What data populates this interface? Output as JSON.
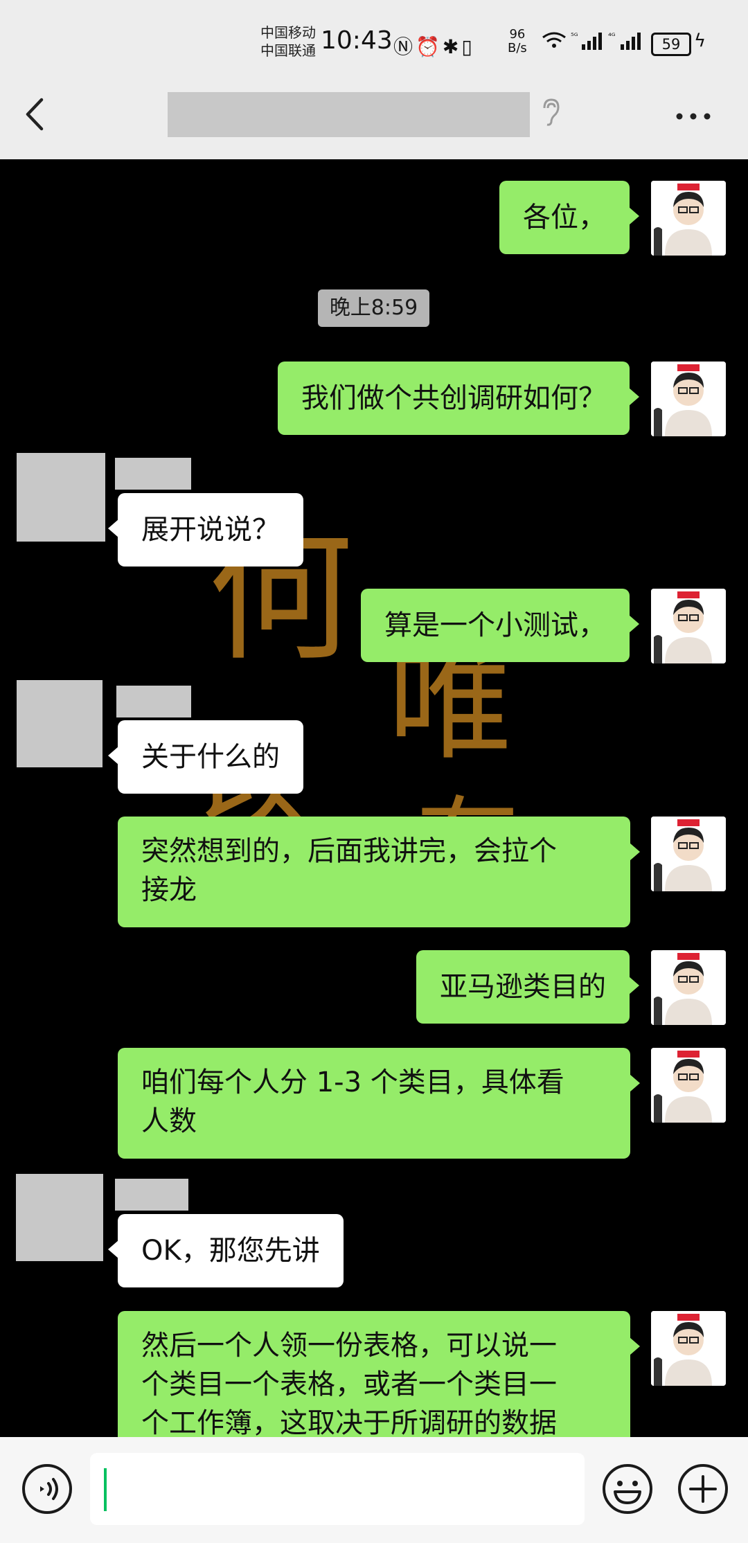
{
  "statusbar": {
    "carrier_1": "中国移动",
    "carrier_2": "中国联通",
    "time": "10:43",
    "icons": "Ⓝ⏰✱▯",
    "speed_value": "96",
    "speed_unit": "B/s",
    "signal_1": "⁶ᵍ",
    "signal_2": "⁵ᴳ",
    "signal_3": "⁴ᴳ",
    "battery": "59"
  },
  "header": {
    "back_icon": "chevron-left-icon",
    "ear_icon": "ear-icon",
    "more_icon": "more-icon"
  },
  "colors": {
    "sent_bubble": "#95ec69",
    "recv_bubble": "#ffffff",
    "bar_bg": "#ededed",
    "chat_bg": "#000000",
    "calligraphy": "#b57a1d"
  },
  "background": {
    "calligraphy_chars": [
      "何",
      "以",
      "唯",
      "有"
    ]
  },
  "messages": [
    {
      "side": "sent",
      "text": "各位，"
    },
    {
      "side": "time",
      "text": "晚上8:59"
    },
    {
      "side": "sent",
      "text": "我们做个共创调研如何？"
    },
    {
      "side": "recv",
      "text": "展开说说？"
    },
    {
      "side": "sent",
      "text": "算是一个小测试，"
    },
    {
      "side": "recv",
      "text": "关于什么的"
    },
    {
      "side": "sent",
      "text": "突然想到的，后面我讲完，会拉个\n接龙"
    },
    {
      "side": "sent",
      "text": "亚马逊类目的"
    },
    {
      "side": "sent",
      "text": "咱们每个人分 1-3 个类目，具体看\n人数"
    },
    {
      "side": "recv",
      "text": "OK，那您先讲"
    },
    {
      "side": "sent",
      "text": "然后一个人领一份表格，可以说一\n个类目一个表格，或者一个类目一\n个工作簿，这取决于所调研的数据"
    }
  ],
  "inputbar": {
    "voice_icon": "voice-icon",
    "emoji_icon": "emoji-icon",
    "plus_icon": "plus-icon",
    "input_value": ""
  }
}
